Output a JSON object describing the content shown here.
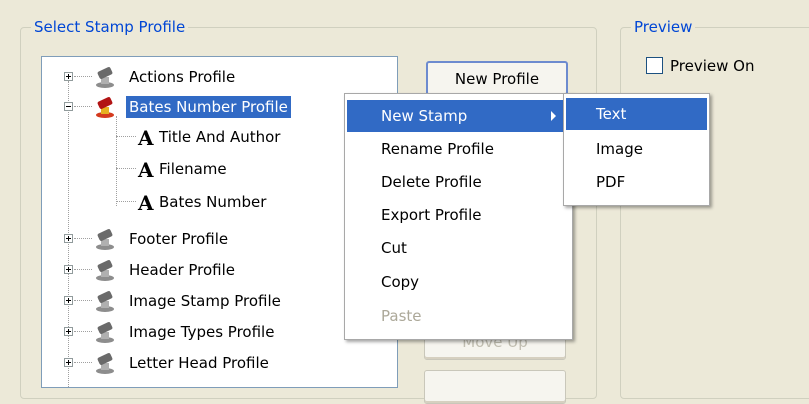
{
  "select_group": {
    "title": "Select Stamp Profile"
  },
  "preview_group": {
    "title": "Preview",
    "checkbox_label": "Preview On",
    "checked": false
  },
  "tree": {
    "items": [
      {
        "label": "Actions Profile",
        "kind": "profile",
        "expanded": false,
        "selected": false
      },
      {
        "label": "Bates Number Profile",
        "kind": "profile",
        "expanded": true,
        "selected": true
      },
      {
        "label": "Title And Author",
        "kind": "text-stamp"
      },
      {
        "label": "Filename",
        "kind": "text-stamp"
      },
      {
        "label": "Bates Number",
        "kind": "text-stamp"
      },
      {
        "label": "Footer Profile",
        "kind": "profile",
        "expanded": false,
        "selected": false
      },
      {
        "label": "Header Profile",
        "kind": "profile",
        "expanded": false,
        "selected": false
      },
      {
        "label": "Image Stamp Profile",
        "kind": "profile",
        "expanded": false,
        "selected": false
      },
      {
        "label": "Image Types Profile",
        "kind": "profile",
        "expanded": false,
        "selected": false
      },
      {
        "label": "Letter Head Profile",
        "kind": "profile",
        "expanded": false,
        "selected": false
      }
    ],
    "text_glyph": "A"
  },
  "buttons": {
    "new_profile": "New Profile",
    "move_up": "Move Up"
  },
  "context_menu": {
    "items": [
      {
        "label": "New Stamp",
        "highlighted": true,
        "submenu": true,
        "enabled": true
      },
      {
        "label": "Rename Profile",
        "enabled": true
      },
      {
        "label": "Delete Profile",
        "enabled": true
      },
      {
        "label": "Export Profile",
        "enabled": true
      },
      {
        "label": "Cut",
        "enabled": true
      },
      {
        "label": "Copy",
        "enabled": true
      },
      {
        "label": "Paste",
        "enabled": false
      }
    ]
  },
  "submenu": {
    "items": [
      {
        "label": "Text",
        "highlighted": true
      },
      {
        "label": "Image"
      },
      {
        "label": "PDF"
      }
    ]
  },
  "colors": {
    "selection": "#316ac5",
    "group_title": "#0046d5",
    "window_bg": "#ece9d8"
  }
}
